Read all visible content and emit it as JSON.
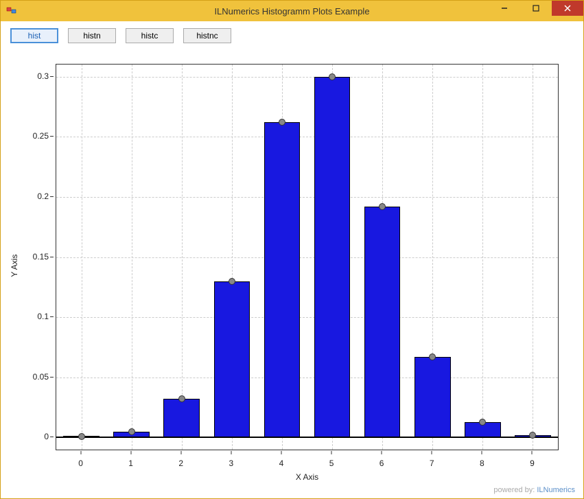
{
  "window": {
    "title": "ILNumerics Histogramm Plots Example"
  },
  "toolbar": {
    "buttons": [
      "hist",
      "histn",
      "histc",
      "histnc"
    ],
    "active": "hist"
  },
  "footer": {
    "prefix": "powered by: ",
    "link": "ILNumerics"
  },
  "chart_data": {
    "type": "bar",
    "categories": [
      0,
      1,
      2,
      3,
      4,
      5,
      6,
      7,
      8,
      9
    ],
    "values": [
      0.001,
      0.005,
      0.032,
      0.13,
      0.262,
      0.3,
      0.192,
      0.067,
      0.013,
      0.002
    ],
    "title": "",
    "xlabel": "X Axis",
    "ylabel": "Y Axis",
    "xlim": [
      -0.5,
      9.5
    ],
    "ylim": [
      -0.01,
      0.31
    ],
    "yticks": [
      0,
      0.05,
      0.1,
      0.15,
      0.2,
      0.25,
      0.3
    ],
    "xticks": [
      0,
      1,
      2,
      3,
      4,
      5,
      6,
      7,
      8,
      9
    ],
    "bar_width_fraction": 0.72,
    "bar_color": "#1818e0",
    "markers": true
  }
}
